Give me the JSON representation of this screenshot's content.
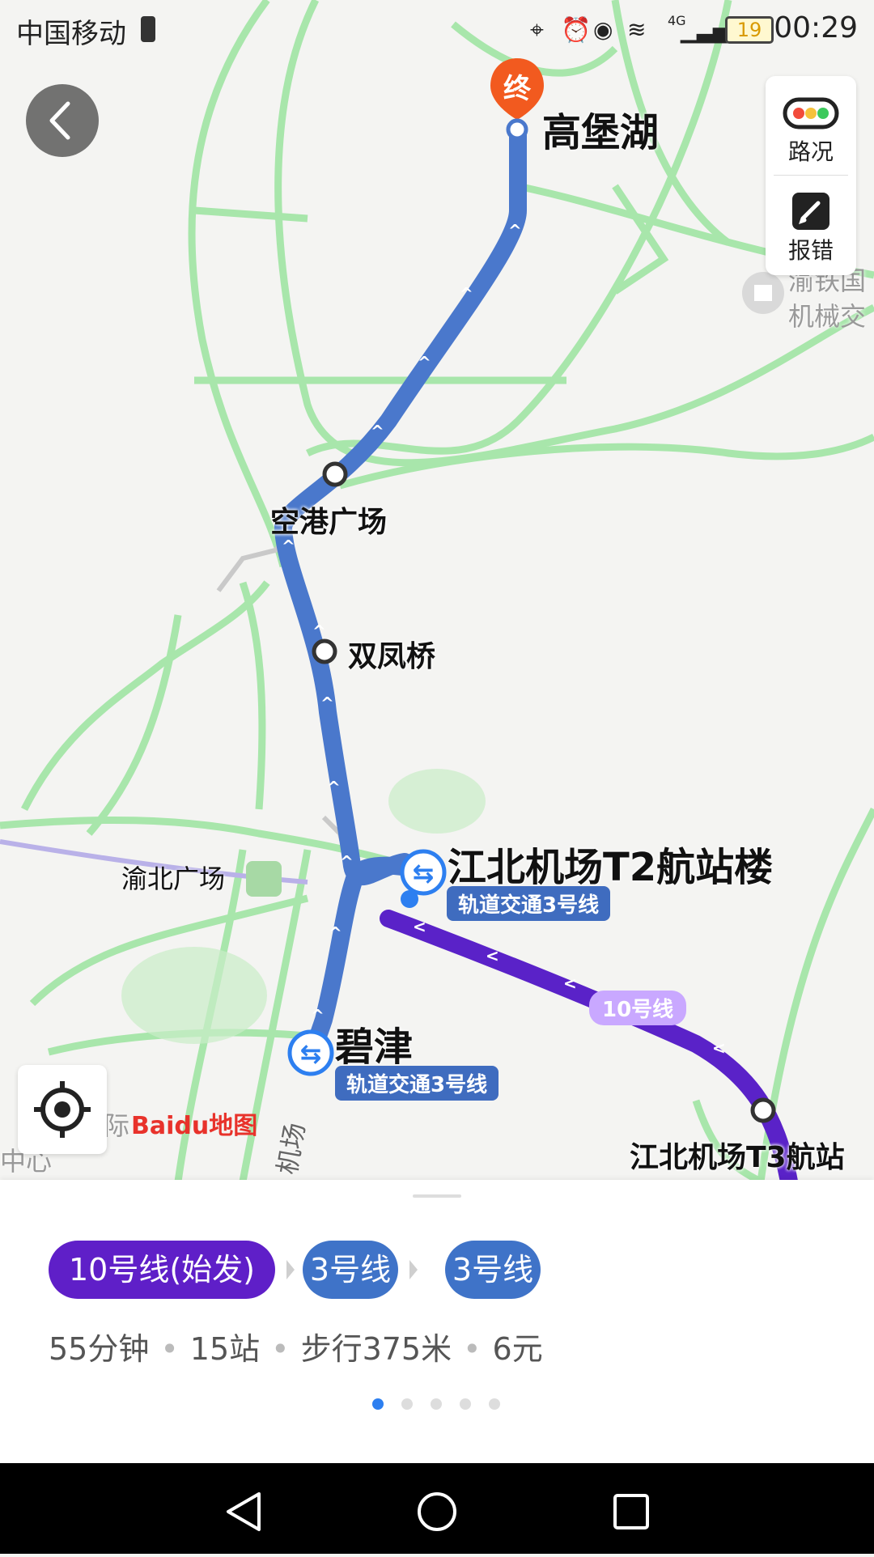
{
  "status_bar": {
    "carrier": "中国移动",
    "battery": "19",
    "network": "4G",
    "time": "00:29"
  },
  "map": {
    "stops": {
      "destination": "高堡湖",
      "destination_marker": "终",
      "stop1": "空港广场",
      "stop2": "双凤桥",
      "transfer1": "江北机场T2航站楼",
      "transfer1_line": "轨道交通3号线",
      "transfer2": "碧津",
      "transfer2_line": "轨道交通3号线",
      "origin": "江北机场T3航站",
      "nearby": "渝北广场"
    },
    "line10_label": "10号线",
    "poi_partial": "机械交",
    "poi_partial_top": "渝铁国",
    "logo": "Baidu地图",
    "road_label": "机场",
    "left_edge_text": "际",
    "left_edge_text2": "中心",
    "traffic_label": "路况",
    "report_label": "报错",
    "colors": {
      "line3": "#4a78cc",
      "line10": "#5a22c8",
      "roads": "#9ee6a0"
    }
  },
  "route": {
    "chips": [
      {
        "label": "10号线(始发)",
        "color": "#5f1fc8"
      },
      {
        "label": "3号线",
        "color": "#3f73c8"
      },
      {
        "label": "3号线",
        "color": "#3f73c8"
      }
    ],
    "duration": "55分钟",
    "stations": "15站",
    "walking": "步行375米",
    "price": "6元",
    "page_count": 5,
    "active_page": 1
  }
}
